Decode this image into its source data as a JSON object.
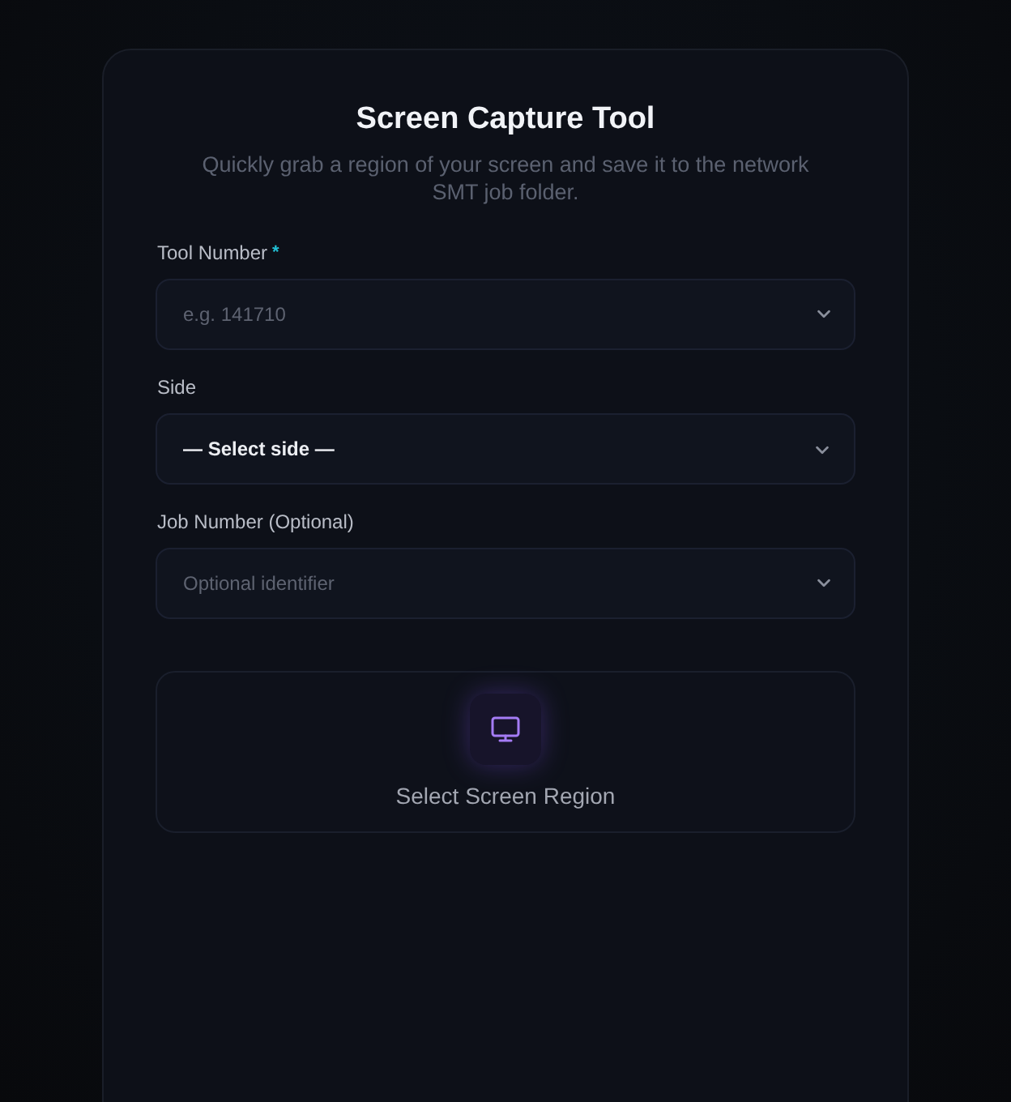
{
  "header": {
    "title": "Screen Capture Tool",
    "subtitle": "Quickly grab a region of your screen and save it to the network SMT job folder."
  },
  "fields": [
    {
      "kind": "combobox",
      "label": "Tool Number",
      "required_mark": "*",
      "placeholder": "e.g. 141710"
    },
    {
      "kind": "select",
      "label": "Side",
      "value": "— Select side —"
    },
    {
      "kind": "combobox",
      "label": "Job Number (Optional)",
      "placeholder": "Optional identifier"
    }
  ],
  "capture_button": {
    "label": "Select Screen Region"
  }
}
